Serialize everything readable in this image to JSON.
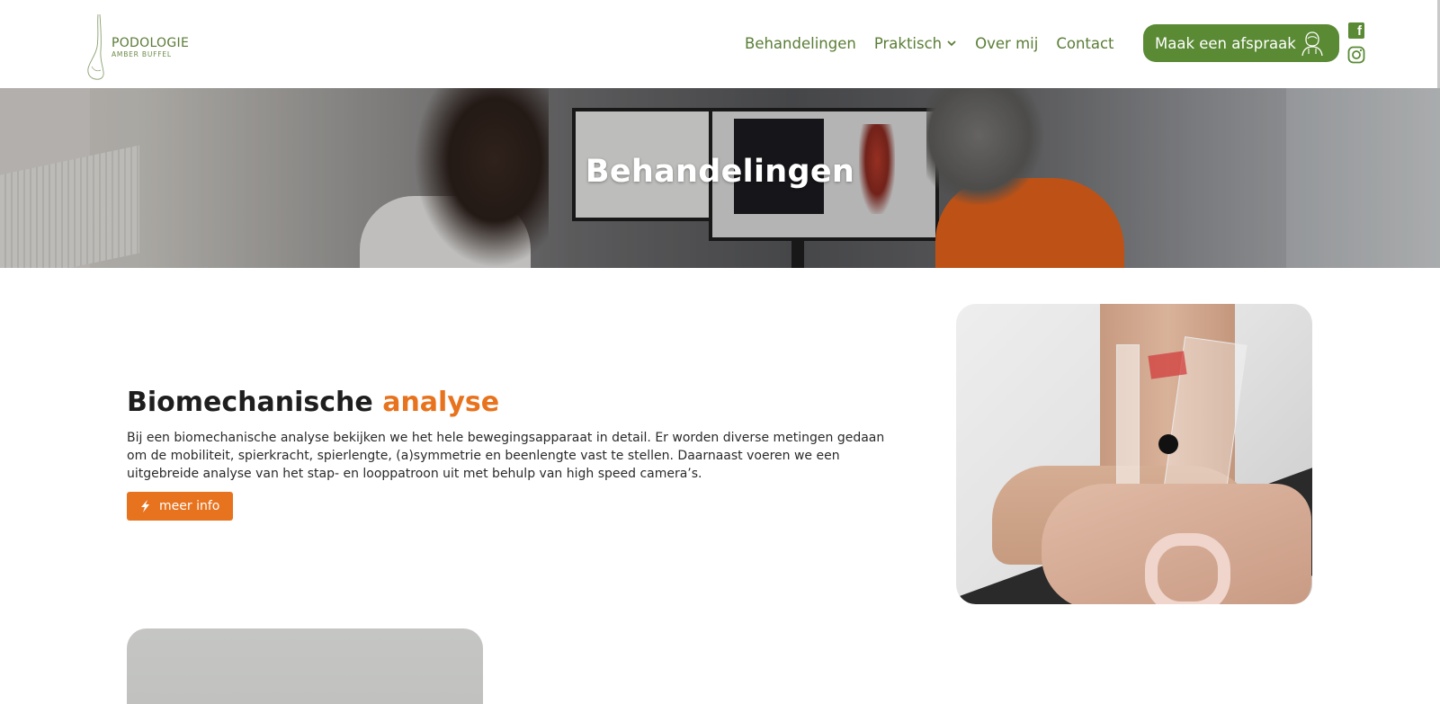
{
  "header": {
    "logo": {
      "title": "PODOLOGIE",
      "subtitle": "AMBER BUFFEL"
    },
    "nav": [
      {
        "label": "Behandelingen"
      },
      {
        "label": "Praktisch"
      },
      {
        "label": "Over mij"
      },
      {
        "label": "Contact"
      }
    ],
    "cta_label": "Maak een afspraak",
    "social": {
      "facebook": "facebook-icon",
      "instagram": "instagram-icon"
    }
  },
  "hero": {
    "title": "Behandelingen"
  },
  "section": {
    "title_main": "Biomechanische",
    "title_accent": "analyse",
    "text": "Bij een biomechanische analyse bekijken we het hele bewegingsapparaat in detail. Er worden diverse metingen gedaan om de mobiliteit, spierkracht, spierlengte, (a)symmetrie en beenlengte vast te stellen. Daarnaast voeren we een uitgebreide analyse van het stap- en looppatroon uit met behulp van high speed camera’s.",
    "button_label": "meer info"
  },
  "colors": {
    "brand_green": "#5a8a34",
    "nav_green": "#5a7d35",
    "accent_orange": "#e8731e",
    "text_dark": "#1e1e1e"
  }
}
